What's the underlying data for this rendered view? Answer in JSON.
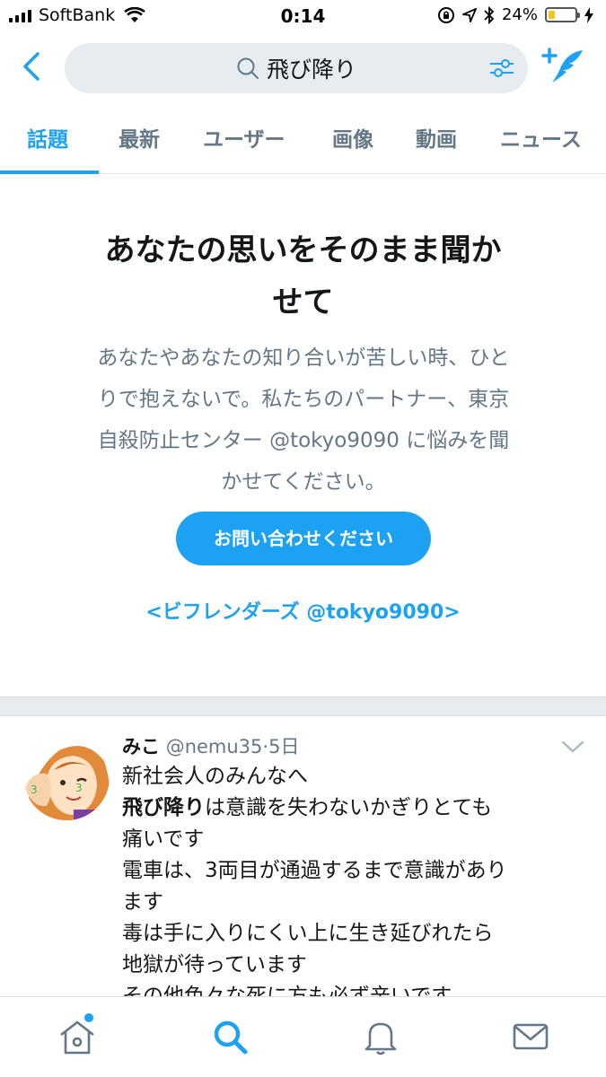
{
  "status": {
    "carrier": "SoftBank",
    "time": "0:14",
    "battery_percent": "24%",
    "battery_level": 0.24
  },
  "search": {
    "query": "飛び降り"
  },
  "tabs": [
    {
      "label": "話題",
      "active": true
    },
    {
      "label": "最新",
      "active": false
    },
    {
      "label": "ユーザー",
      "active": false
    },
    {
      "label": "画像",
      "active": false
    },
    {
      "label": "動画",
      "active": false
    },
    {
      "label": "ニュース",
      "active": false
    }
  ],
  "hero": {
    "title_line1": "あなたの思いをそのまま聞か",
    "title_line2": "せて",
    "body_lines": [
      "あなたやあなたの知り合いが苦しい時、ひと",
      "りで抱えないで。私たちのパートナー、東京",
      "自殺防止センター @tokyo9090 に悩みを聞",
      "かせてください。"
    ],
    "button_label": "お問い合わせください",
    "link_text": "<ビフレンダーズ @tokyo9090>"
  },
  "tweet": {
    "name": "みこ",
    "handle": "@nemu35",
    "time": "5日",
    "lines": [
      "新社会人のみんなへ",
      "飛び降りは意識を失わないかぎりとても",
      "痛いです",
      "電車は、3両目が通過するまで意識があり",
      "ます",
      "毒は手に入りにくい上に生き延びれたら",
      "地獄が待っています",
      "その他色々な死に方も必ず辛いです"
    ],
    "highlight": "飛び降り",
    "line2_rest": "は意識を失わないかぎりとても"
  },
  "colors": {
    "accent": "#1da1f2",
    "text_secondary": "#657786",
    "divider": "#e6ecf0"
  }
}
